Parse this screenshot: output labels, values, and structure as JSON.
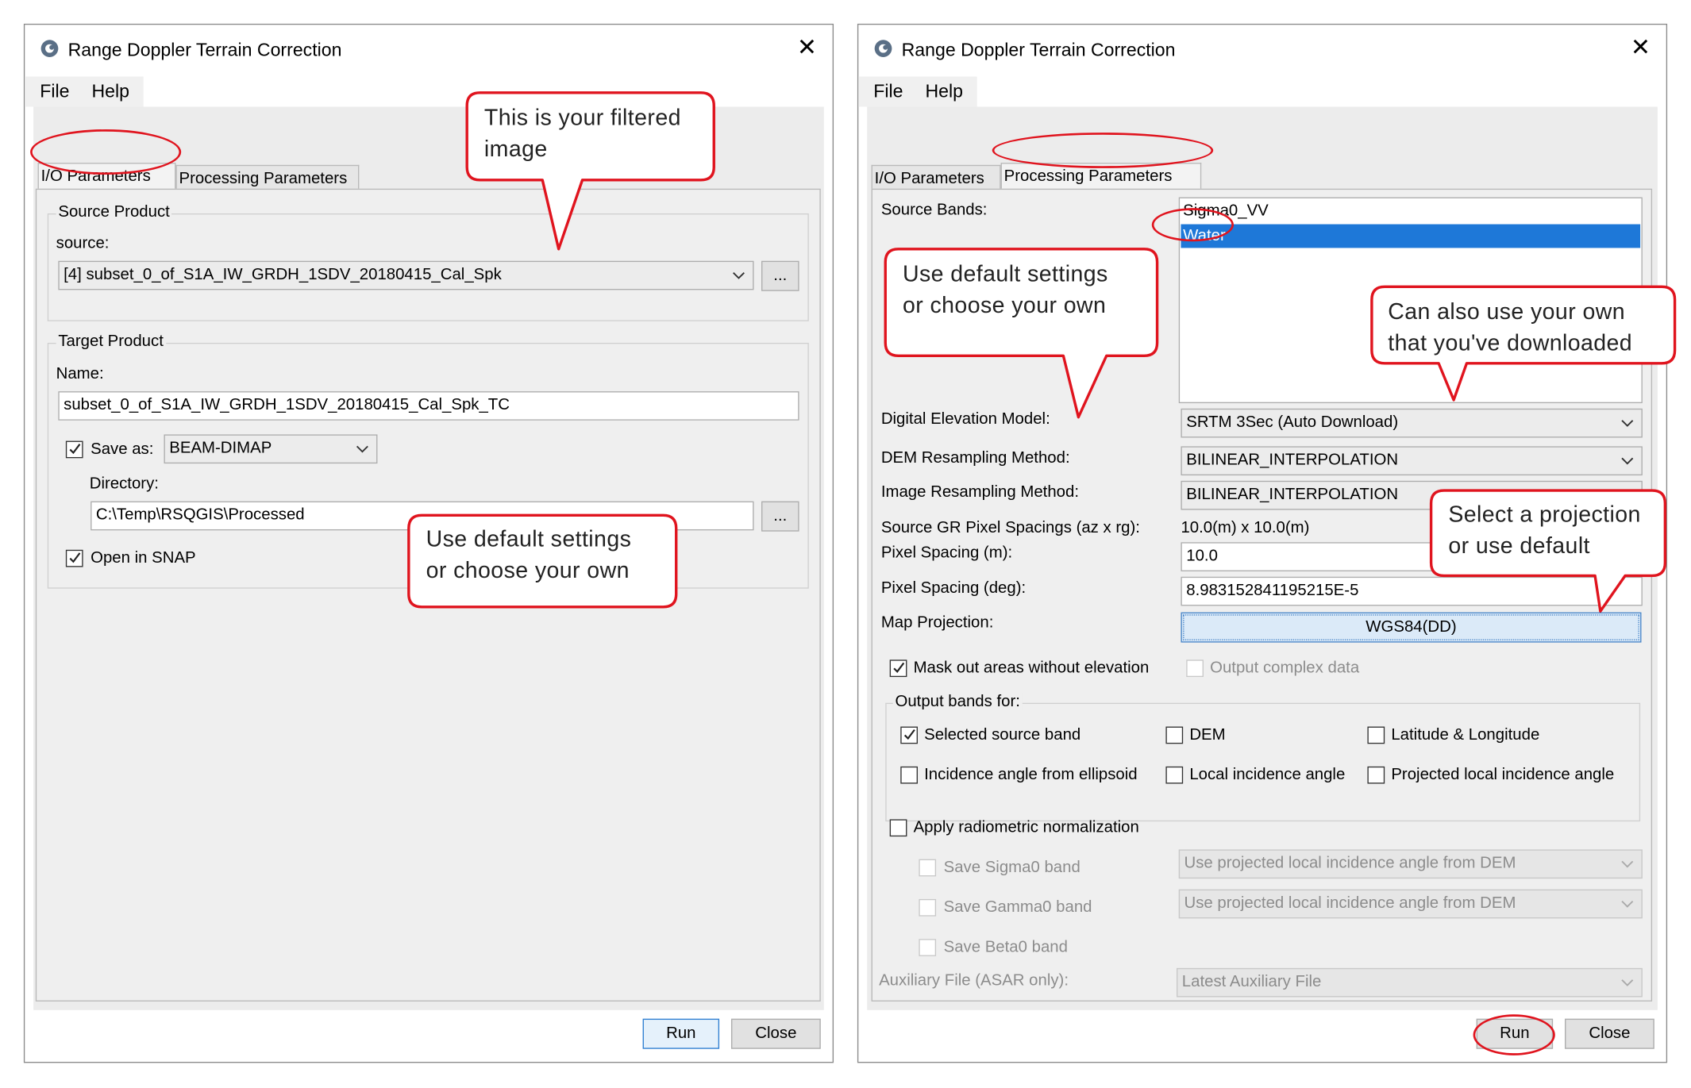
{
  "left_dialog": {
    "title": "Range Doppler Terrain Correction",
    "menu": [
      "File",
      "Help"
    ],
    "tabs": [
      "I/O Parameters",
      "Processing Parameters"
    ],
    "source_product": {
      "group_label": "Source Product",
      "source_label": "source:",
      "source_value": "[4] subset_0_of_S1A_IW_GRDH_1SDV_20180415_Cal_Spk",
      "browse_label": "..."
    },
    "target_product": {
      "group_label": "Target Product",
      "name_label": "Name:",
      "name_value": "subset_0_of_S1A_IW_GRDH_1SDV_20180415_Cal_Spk_TC",
      "save_as_label": "Save as:",
      "save_as_checked": true,
      "format_value": "BEAM-DIMAP",
      "directory_label": "Directory:",
      "directory_value": "C:\\Temp\\RSQGIS\\Processed",
      "browse_label": "...",
      "open_in_snap_label": "Open in SNAP",
      "open_in_snap_checked": true
    },
    "buttons": {
      "run": "Run",
      "close": "Close"
    }
  },
  "right_dialog": {
    "title": "Range Doppler Terrain Correction",
    "menu": [
      "File",
      "Help"
    ],
    "tabs": [
      "I/O Parameters",
      "Processing Parameters"
    ],
    "source_bands_label": "Source Bands:",
    "source_bands": [
      "Sigma0_VV",
      "Water"
    ],
    "selected_band": "Water",
    "dem_label": "Digital Elevation Model:",
    "dem_value": "SRTM 3Sec (Auto Download)",
    "dem_resampling_label": "DEM Resampling Method:",
    "dem_resampling_value": "BILINEAR_INTERPOLATION",
    "image_resampling_label": "Image Resampling Method:",
    "image_resampling_value": "BILINEAR_INTERPOLATION",
    "gr_spacings_label": "Source GR Pixel Spacings (az x rg):",
    "gr_spacings_value": "10.0(m) x 10.0(m)",
    "pixel_spacing_m_label": "Pixel Spacing (m):",
    "pixel_spacing_m_value": "10.0",
    "pixel_spacing_deg_label": "Pixel Spacing (deg):",
    "pixel_spacing_deg_value": "8.983152841195215E-5",
    "map_projection_label": "Map Projection:",
    "map_projection_value": "WGS84(DD)",
    "mask_label": "Mask out areas without elevation",
    "mask_checked": true,
    "complex_label": "Output complex data",
    "output_bands_label": "Output bands for:",
    "output_bands": {
      "selected_source_band": "Selected source band",
      "dem": "DEM",
      "lat_lon": "Latitude & Longitude",
      "incidence_ellipsoid": "Incidence angle from ellipsoid",
      "local_incidence": "Local incidence angle",
      "projected_local_incidence": "Projected local incidence angle"
    },
    "apply_radiometric_label": "Apply radiometric normalization",
    "save_sigma0_label": "Save Sigma0 band",
    "save_gamma0_label": "Save Gamma0 band",
    "save_beta0_label": "Save Beta0 band",
    "incidence_source_value": "Use projected local incidence angle from DEM",
    "auxiliary_label": "Auxiliary File (ASAR only):",
    "auxiliary_value": "Latest Auxiliary File",
    "buttons": {
      "run": "Run",
      "close": "Close"
    }
  },
  "callouts": {
    "filtered_image": [
      "This is your filtered",
      "image"
    ],
    "left_defaults": [
      "Use default settings",
      "or choose your own"
    ],
    "right_defaults": [
      "Use default settings",
      "or choose your own"
    ],
    "own_dem": [
      "Can also use your own",
      "that you've downloaded"
    ],
    "projection": [
      "Select a projection",
      "or use default"
    ]
  },
  "colors": {
    "annotation_red": "#e0141e",
    "selection_blue": "#1e78d8"
  }
}
